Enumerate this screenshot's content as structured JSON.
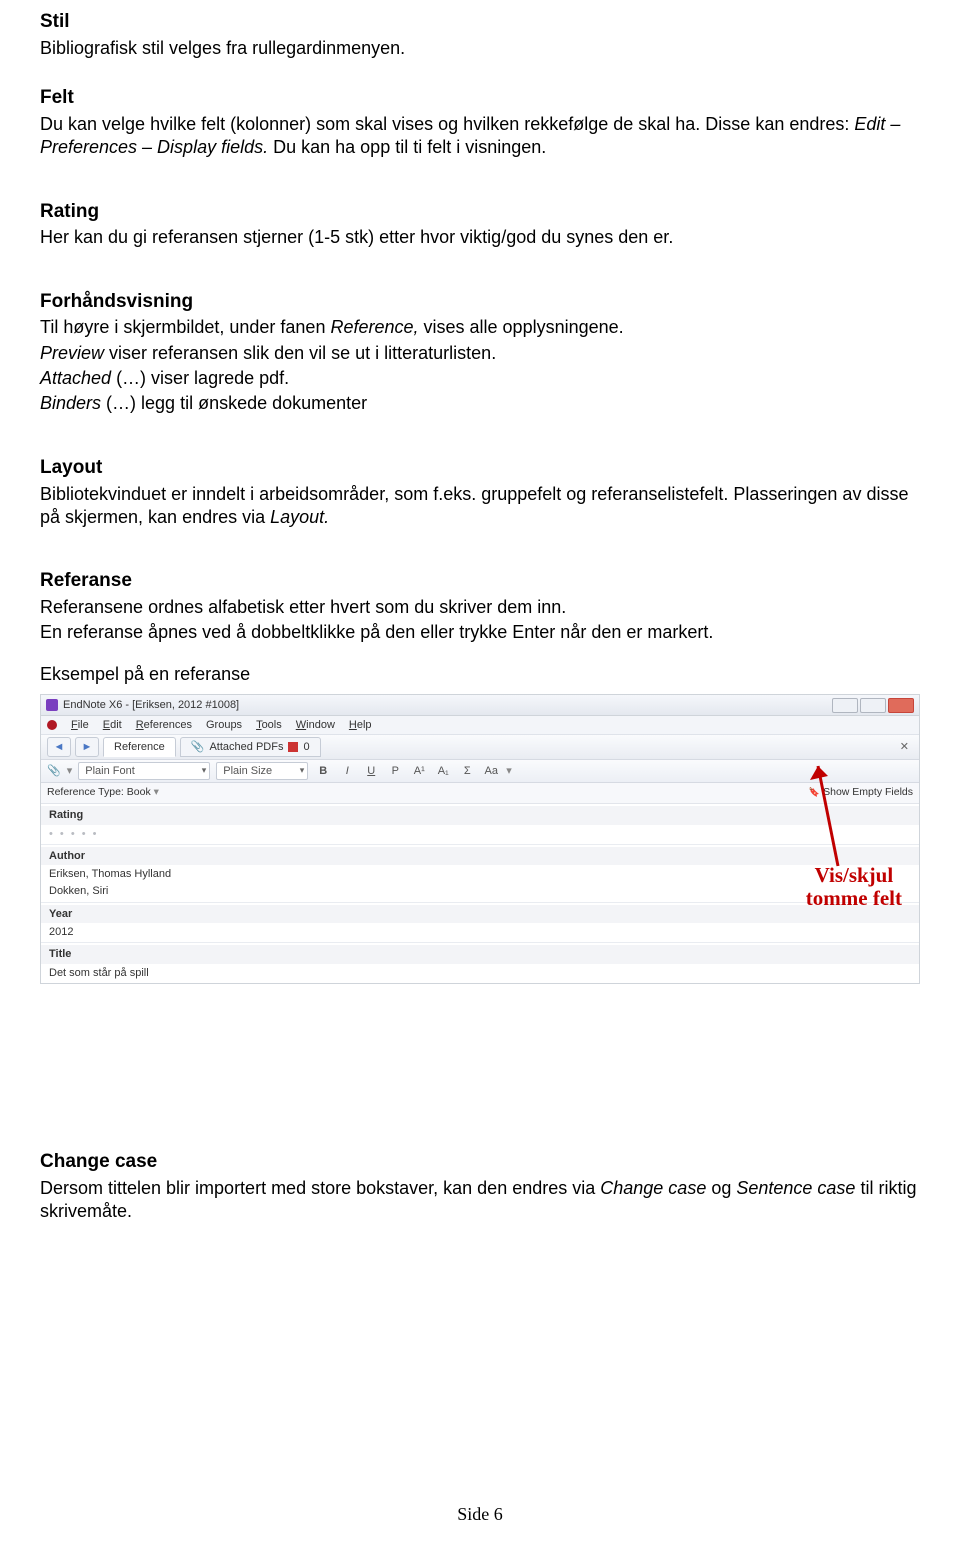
{
  "sections": {
    "stil": {
      "heading": "Stil",
      "p1": "Bibliografisk stil velges fra rullegardinmenyen."
    },
    "felt": {
      "heading": "Felt",
      "p1a": "Du kan velge hvilke felt (kolonner) som skal vises og hvilken rekkefølge de skal ha. Disse kan endres: ",
      "p1b_it": "Edit – Preferences – Display fields.",
      "p1c": " Du kan ha opp til ti felt i visningen."
    },
    "rating": {
      "heading": "Rating",
      "p1": "Her kan du gi referansen stjerner (1-5 stk) etter hvor viktig/god du synes den er."
    },
    "forhand": {
      "heading": "Forhåndsvisning",
      "l1a": "Til høyre i skjermbildet, under fanen ",
      "l1b_it": "Reference,",
      "l1c": " vises alle opplysningene.",
      "l2_it": "Preview",
      "l2b": " viser referansen slik den vil se ut i litteraturlisten.",
      "l3_it": "Attached",
      "l3b": " (…) viser lagrede pdf.",
      "l4_it": "Binders ",
      "l4b": " (…) legg til ønskede dokumenter"
    },
    "layout": {
      "heading": "Layout",
      "p1": "Bibliotekvinduet er inndelt i arbeidsområder, som f.eks. gruppefelt og referanselistefelt. Plasseringen av disse på skjermen, kan endres via ",
      "p1b_it": "Layout."
    },
    "referanse": {
      "heading": "Referanse",
      "p1": "Referansene ordnes alfabetisk etter hvert som du skriver dem inn.",
      "p2": "En referanse åpnes ved å dobbeltklikke på den eller trykke Enter når den er markert.",
      "eks": "Eksempel på en referanse"
    },
    "changecase": {
      "heading": "Change case",
      "p1a": "Dersom tittelen blir importert med store bokstaver, kan den endres via ",
      "p1b_it": "Change case",
      "p1c": " og ",
      "p1d_it": "Sentence case",
      "p1e": " til riktig skrivemåte."
    }
  },
  "screenshot": {
    "title": "EndNote X6 - [Eriksen, 2012 #1008]",
    "menus": {
      "file": "File",
      "edit": "Edit",
      "references": "References",
      "groups": "Groups",
      "tools": "Tools",
      "window": "Window",
      "help": "Help"
    },
    "nav_back": "◄",
    "nav_fwd": "►",
    "tab_reference": "Reference",
    "tab_attached": "Attached PDFs",
    "attached_count": "0",
    "toolbar_close": "✕",
    "font_dd": "Plain Font",
    "size_dd": "Plain Size",
    "fmt": {
      "b": "B",
      "i": "I",
      "u": "U",
      "p": "P",
      "a1": "A¹",
      "a2": "A₁",
      "sigma": "Σ",
      "aa": "Aa"
    },
    "type_label": "Reference Type:",
    "type_value": "Book",
    "show_empty": "Show Empty Fields",
    "fields": {
      "rating": "Rating",
      "rating_val": "• • • • •",
      "author": "Author",
      "author_val1": "Eriksen, Thomas Hylland",
      "author_val2": "Dokken, Siri",
      "year": "Year",
      "year_val": "2012",
      "title": "Title",
      "title_val": "Det som står på spill"
    }
  },
  "annotation": {
    "line1": "Vis/skjul",
    "line2": "tomme felt"
  },
  "footer": "Side 6"
}
